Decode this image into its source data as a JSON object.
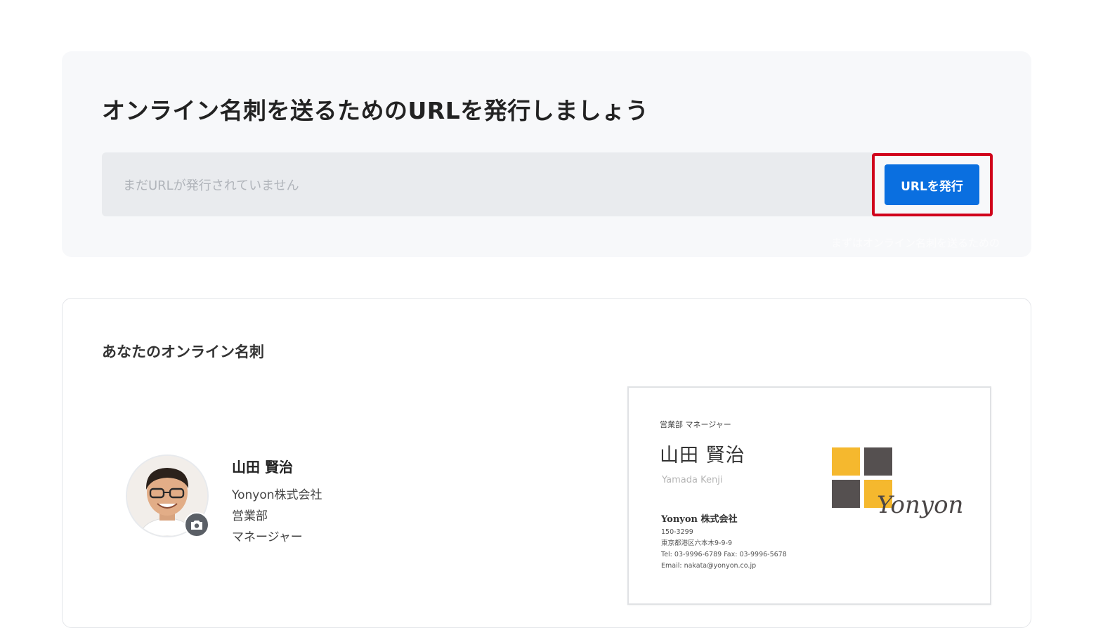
{
  "url_panel": {
    "title": "オンライン名刺を送るためのURLを発行しましょう",
    "url_placeholder": "まだURLが発行されていません",
    "issue_button_label": "URLを発行",
    "faint_note": "まずはオンライン名刺を送るための"
  },
  "card_panel": {
    "heading": "あなたのオンライン名刺",
    "profile": {
      "name": "山田 賢治",
      "company": "Yonyon株式会社",
      "department": "営業部",
      "title": "マネージャー"
    },
    "business_card": {
      "title_line": "営業部  マネージャー",
      "name": "山田 賢治",
      "romaji": "Yamada Kenji",
      "company": "Yonyon 株式会社",
      "postal": "150-3299",
      "address": "東京都港区六本木9-9-9",
      "phone_fax": "Tel: 03-9996-6789    Fax: 03-9996-5678",
      "email": "Email: nakata@yonyon.co.jp",
      "logo_text": "Yonyon"
    }
  },
  "colors": {
    "primary_button": "#0a6fe0",
    "highlight_border": "#d0021b",
    "logo_yellow": "#f5b82e",
    "logo_gray": "#555050"
  },
  "icons": {
    "avatar_badge": "camera-icon"
  }
}
